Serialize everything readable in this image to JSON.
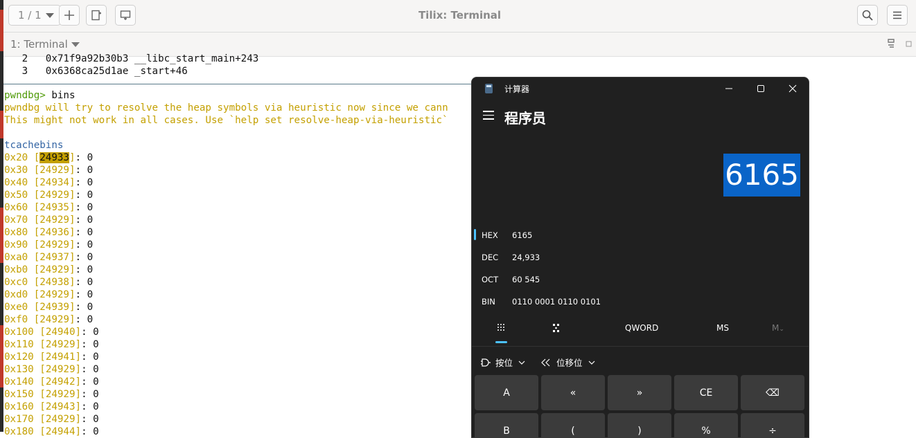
{
  "header": {
    "session_label": "1 / 1",
    "title": "Tilix: Terminal"
  },
  "terminal_tab": {
    "name": "1: Terminal"
  },
  "terminal": {
    "backtrace": [
      {
        "num": "2",
        "text": "0x71f9a92b30b3 __libc_start_main+243"
      },
      {
        "num": "3",
        "text": "0x6368ca25d1ae _start+46"
      }
    ],
    "prompt": "pwndbg>",
    "command": "bins",
    "warning1": "pwndbg will try to resolve the heap symbols via heuristic now since we cann",
    "warning2": "This might not work in all cases. Use `help set resolve-heap-via-heuristic`",
    "section": "tcachebins",
    "first_size": "0x20",
    "first_id": "24933",
    "first_value": "0",
    "rows": [
      {
        "size": "0x30",
        "id": "24929",
        "value": "0"
      },
      {
        "size": "0x40",
        "id": "24934",
        "value": "0"
      },
      {
        "size": "0x50",
        "id": "24929",
        "value": "0"
      },
      {
        "size": "0x60",
        "id": "24935",
        "value": "0"
      },
      {
        "size": "0x70",
        "id": "24929",
        "value": "0"
      },
      {
        "size": "0x80",
        "id": "24936",
        "value": "0"
      },
      {
        "size": "0x90",
        "id": "24929",
        "value": "0"
      },
      {
        "size": "0xa0",
        "id": "24937",
        "value": "0"
      },
      {
        "size": "0xb0",
        "id": "24929",
        "value": "0"
      },
      {
        "size": "0xc0",
        "id": "24938",
        "value": "0"
      },
      {
        "size": "0xd0",
        "id": "24929",
        "value": "0"
      },
      {
        "size": "0xe0",
        "id": "24939",
        "value": "0"
      },
      {
        "size": "0xf0",
        "id": "24929",
        "value": "0"
      },
      {
        "size": "0x100",
        "id": "24940",
        "value": "0"
      },
      {
        "size": "0x110",
        "id": "24929",
        "value": "0"
      },
      {
        "size": "0x120",
        "id": "24941",
        "value": "0"
      },
      {
        "size": "0x130",
        "id": "24929",
        "value": "0"
      },
      {
        "size": "0x140",
        "id": "24942",
        "value": "0"
      },
      {
        "size": "0x150",
        "id": "24929",
        "value": "0"
      },
      {
        "size": "0x160",
        "id": "24943",
        "value": "0"
      },
      {
        "size": "0x170",
        "id": "24929",
        "value": "0"
      },
      {
        "size": "0x180",
        "id": "24944",
        "value": "0"
      }
    ]
  },
  "calculator": {
    "title": "计算器",
    "mode": "程序员",
    "display": "6165",
    "radix": [
      {
        "label": "HEX",
        "value": "6165"
      },
      {
        "label": "DEC",
        "value": "24,933"
      },
      {
        "label": "OCT",
        "value": "60 545"
      },
      {
        "label": "BIN",
        "value": "0110 0001 0110 0101"
      }
    ],
    "word_size": "QWORD",
    "memory_store": "MS",
    "memory_recall": "M",
    "bitwise_label": "按位",
    "bitshift_label": "位移位",
    "keys_row1": [
      "A",
      "«",
      "»",
      "CE",
      "⌫"
    ],
    "keys_row2": [
      "B",
      "(",
      ")",
      "%",
      "÷"
    ]
  },
  "colors": {
    "accent": "#4cc2ff",
    "display_highlight": "#0a64c8",
    "terminal_yellow": "#c4a000",
    "prompt_green": "#4e9a06",
    "tcache_blue": "#3465a4"
  }
}
